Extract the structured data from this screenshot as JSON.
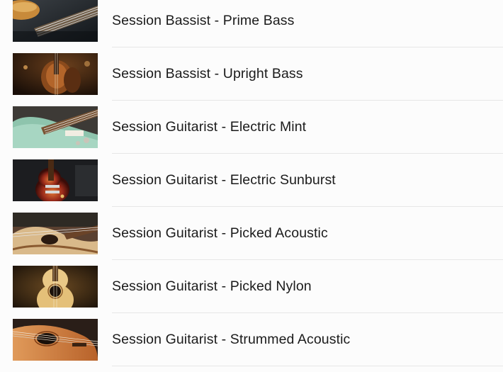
{
  "instruments": [
    {
      "label": "Session Bassist - Prime Bass",
      "thumbnail_icon": "electric-bass-neck-image"
    },
    {
      "label": "Session Bassist - Upright Bass",
      "thumbnail_icon": "upright-bass-image"
    },
    {
      "label": "Session Guitarist - Electric Mint",
      "thumbnail_icon": "mint-electric-guitar-image"
    },
    {
      "label": "Session Guitarist - Electric Sunburst",
      "thumbnail_icon": "sunburst-electric-guitar-image"
    },
    {
      "label": "Session Guitarist - Picked Acoustic",
      "thumbnail_icon": "acoustic-guitar-image"
    },
    {
      "label": "Session Guitarist - Picked Nylon",
      "thumbnail_icon": "nylon-guitar-image"
    },
    {
      "label": "Session Guitarist - Strummed Acoustic",
      "thumbnail_icon": "strummed-acoustic-guitar-image"
    }
  ],
  "colors": {
    "background": "#fcfcfc",
    "text": "#1b1b1b",
    "divider": "#e6e6e6"
  }
}
